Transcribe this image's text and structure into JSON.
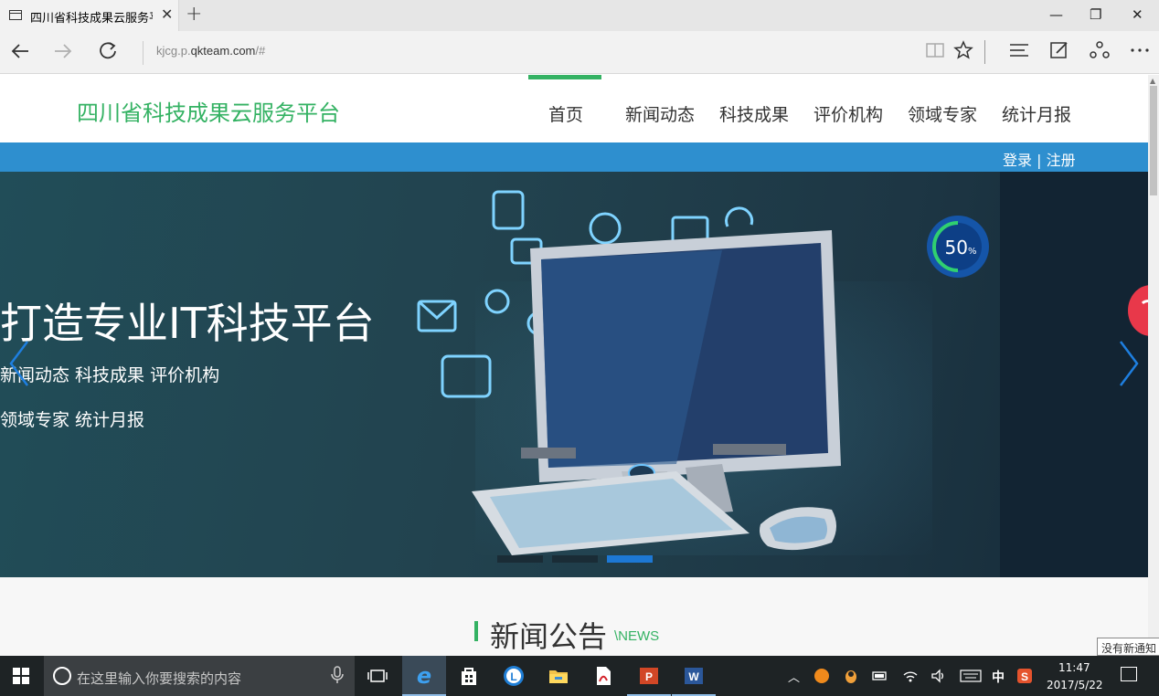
{
  "browser": {
    "tab_title": "四川省科技成果云服务平",
    "tab_close": "✕",
    "new_tab": "+",
    "minimize": "—",
    "restore": "❐",
    "close": "✕",
    "url_prefix": "kjcg.p.",
    "url_domain": "qkteam.com",
    "url_suffix": "/#",
    "back_icon": "arrow-left-icon",
    "forward_icon": "arrow-right-icon",
    "refresh_icon": "refresh-icon"
  },
  "site": {
    "title": "四川省科技成果云服务平台",
    "menu": [
      {
        "label": "首页",
        "active": true
      },
      {
        "label": "新闻动态"
      },
      {
        "label": "科技成果"
      },
      {
        "label": "评价机构"
      },
      {
        "label": "领域专家"
      },
      {
        "label": "统计月报"
      }
    ],
    "login": "登录",
    "login_sep": "|",
    "register": "注册"
  },
  "banner": {
    "heading": "打造专业IT科技平台",
    "line1": "新闻动态  科技成果  评价机构",
    "line2": "领域专家  统计月报",
    "badge_value": "50",
    "badge_unit": "%",
    "slide_count": 3,
    "active_slide": 3
  },
  "news": {
    "title": "新闻公告",
    "subtitle": "\\NEWS"
  },
  "tooltip": "没有新通知",
  "taskbar": {
    "search_placeholder": "在这里输入你要搜索的内容",
    "ime": "中",
    "time": "11:47",
    "date": "2017/5/22"
  },
  "colors": {
    "brand_green": "#34b263",
    "login_bar": "#2e8fcf",
    "slide_active": "#1d78d4"
  }
}
